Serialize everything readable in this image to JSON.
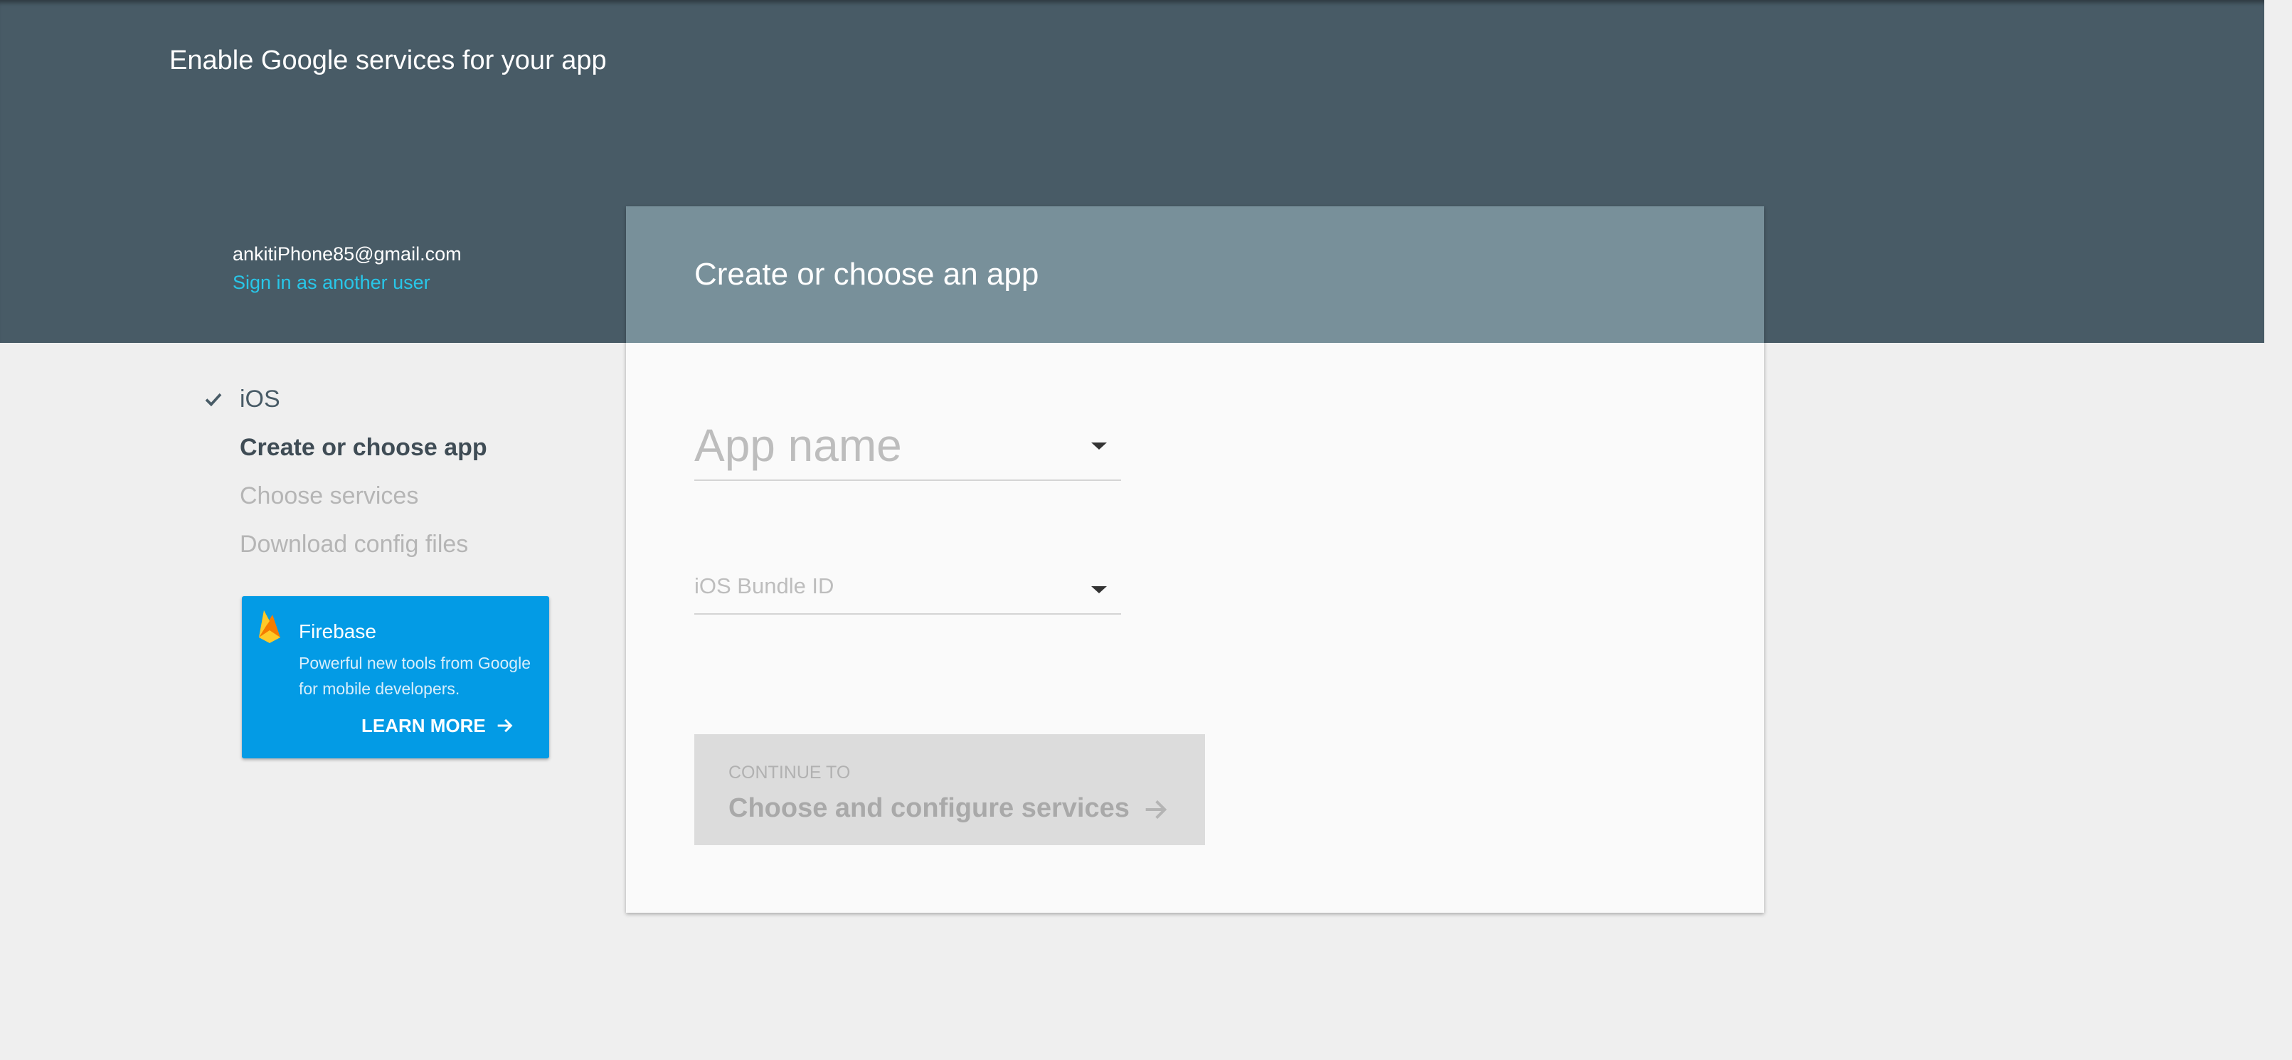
{
  "header": {
    "title": "Enable Google services for your app",
    "user_email": "ankitiPhone85@gmail.com",
    "switch_user_label": "Sign in as another user"
  },
  "steps": [
    {
      "label": "iOS",
      "state": "done"
    },
    {
      "label": "Create or choose app",
      "state": "active"
    },
    {
      "label": "Choose services",
      "state": "pending"
    },
    {
      "label": "Download config files",
      "state": "pending"
    }
  ],
  "promo": {
    "title": "Firebase",
    "description": "Powerful new tools from Google for mobile developers.",
    "link_label": "LEARN MORE",
    "icon": "firebase-flame-icon"
  },
  "card": {
    "title": "Create or choose an app",
    "app_name": {
      "placeholder": "App name",
      "value": ""
    },
    "bundle_id": {
      "placeholder": "iOS Bundle ID",
      "value": ""
    },
    "continue_button": {
      "small_label": "CONTINUE TO",
      "main_label": "Choose and configure services",
      "enabled": false
    }
  },
  "colors": {
    "header_bg": "#485b66",
    "card_header_bg": "#78909a",
    "link_accent": "#28c6e8",
    "promo_bg": "#039be5",
    "page_bg": "#efefef",
    "card_bg": "#fafafa",
    "button_disabled_bg": "#dcdcdc"
  },
  "icons": {
    "check": "check-icon",
    "dropdown": "caret-down-icon",
    "arrow": "arrow-right-icon"
  }
}
